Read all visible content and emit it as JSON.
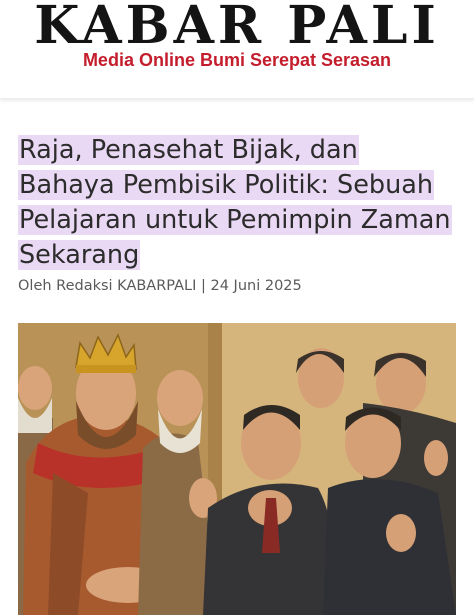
{
  "site": {
    "name": "KABAR PALI",
    "tagline": "Media Online Bumi Serepat Serasan"
  },
  "article": {
    "title": "Raja, Penasehat Bijak, dan Bahaya Pembisik Politik: Sebuah Pelajaran untuk Pemimpin Zaman Sekarang",
    "byline": "Oleh Redaksi KABARPALI | 24 Juni 2025"
  },
  "colors": {
    "tagline": "#c41e2d",
    "title_highlight": "#ead9f4",
    "logo": "#141414"
  }
}
